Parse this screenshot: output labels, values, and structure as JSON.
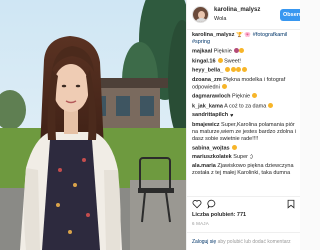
{
  "post": {
    "username": "karolina_malysz",
    "location": "Wola",
    "follow_label": "Obserwuj",
    "caption": {
      "user": "karolina_malysz",
      "text": "🏆 🌸 #fotografkamil #spring"
    },
    "likes_text": "Liczba polubień: 771",
    "date_text": "6 MAJA"
  },
  "comments": [
    {
      "user": "majkaal",
      "text": "Pięknie"
    },
    {
      "user": "kingal.16",
      "text": "Sweet!"
    },
    {
      "user": "heyy_bella_",
      "text": ""
    },
    {
      "user": "dzoana_zm",
      "text": "Piękna modelka i fotograf odpowiedni"
    },
    {
      "user": "dagmarawloch",
      "text": "Pięknie"
    },
    {
      "user": "k_jak_kama",
      "text": "A coż to za dama"
    },
    {
      "user": "sandrittapilch",
      "text": ""
    },
    {
      "user": "bmajewicz",
      "text": "Super,Karolina polamania piór na maturze,wiem ze jestes bardzo zdolna i dasz sobie swietnie rade!!!!"
    },
    {
      "user": "sabina_wojtas",
      "text": ""
    },
    {
      "user": "mariuszkolatek",
      "text": "Super ;)"
    },
    {
      "user": "ala.maria",
      "text": "Zjawiskowo piękna dziewczyna została z tej małej Karolinki, taka dumna"
    }
  ],
  "footer": {
    "login_label": "Zaloguj się",
    "rest_label": " aby polubić lub dodać komentarz"
  },
  "colors": {
    "link_blue": "#003569",
    "button_blue": "#3897f0",
    "like_red": "#ed4956",
    "border": "#efefef"
  },
  "icons": [
    "heart-icon",
    "comment-icon",
    "bookmark-icon",
    "more-options-icon"
  ]
}
